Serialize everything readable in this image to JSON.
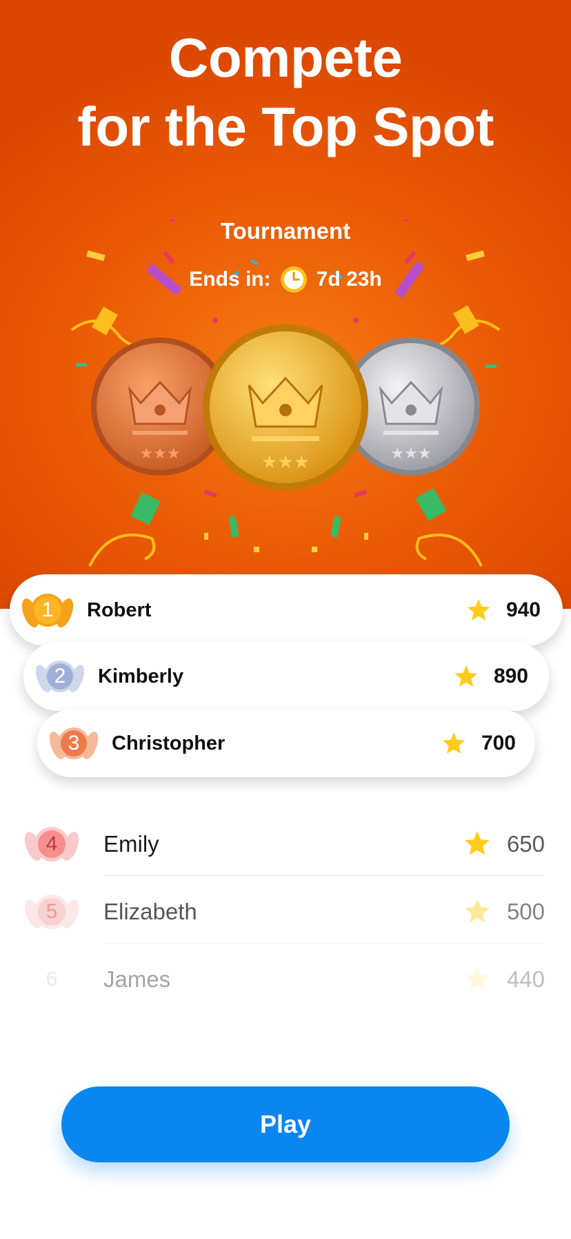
{
  "headline": {
    "line1": "Compete",
    "line2": "for the Top Spot"
  },
  "tournament": {
    "title": "Tournament",
    "ends_label": "Ends in:",
    "ends_value": "7d 23h"
  },
  "podium": [
    {
      "rank": "1",
      "name": "Robert",
      "score": "940",
      "badge_color": "#f6a21a"
    },
    {
      "rank": "2",
      "name": "Kimberly",
      "score": "890",
      "badge_color": "#9fb0d6"
    },
    {
      "rank": "3",
      "name": "Christopher",
      "score": "700",
      "badge_color": "#ee7a4c"
    }
  ],
  "list": [
    {
      "rank": "4",
      "name": "Emily",
      "score": "650",
      "badge_color": "#f58f8f"
    },
    {
      "rank": "5",
      "name": "Elizabeth",
      "score": "500",
      "badge_color": "#f8c2c2"
    },
    {
      "rank": "6",
      "name": "James",
      "score": "440"
    }
  ],
  "play_label": "Play",
  "colors": {
    "hero_bg": "#e05005",
    "play_button": "#0a86f0",
    "star": "#ffcc1a",
    "medal_gold": "#f2b21e",
    "medal_bronze": "#e07438",
    "medal_silver": "#c8c8cc"
  }
}
